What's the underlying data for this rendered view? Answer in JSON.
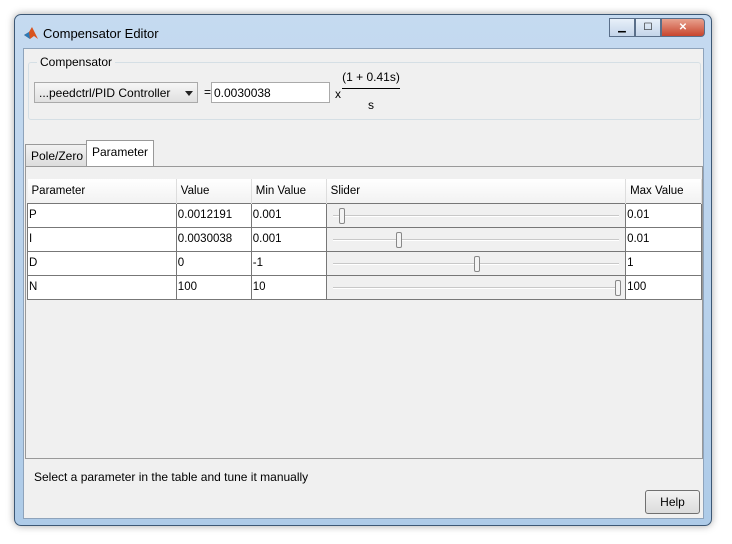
{
  "window": {
    "title": "Compensator Editor",
    "minimize": "▁",
    "maximize": "☐",
    "close": "✕"
  },
  "compensator": {
    "group_label": "Compensator",
    "block": "...peedctrl/PID Controller",
    "equals": "=",
    "gain": "0.0030038",
    "times": "x",
    "numerator": "(1 + 0.41s)",
    "denominator": "s"
  },
  "tabs": [
    {
      "label": "Pole/Zero",
      "active": false
    },
    {
      "label": "Parameter",
      "active": true
    }
  ],
  "table": {
    "headers": [
      "Parameter",
      "Value",
      "Min Value",
      "Slider",
      "Max Value"
    ],
    "rows": [
      {
        "name": "P",
        "value": "0.0012191",
        "min": "0.001",
        "max": "0.01",
        "slider": 0.024
      },
      {
        "name": "I",
        "value": "0.0030038",
        "min": "0.001",
        "max": "0.01",
        "slider": 0.223
      },
      {
        "name": "D",
        "value": "0",
        "min": "-1",
        "max": "1",
        "slider": 0.5
      },
      {
        "name": "N",
        "value": "100",
        "min": "10",
        "max": "100",
        "slider": 1.0
      }
    ]
  },
  "status": "Select a parameter in the table and tune it manually",
  "help_label": "Help"
}
